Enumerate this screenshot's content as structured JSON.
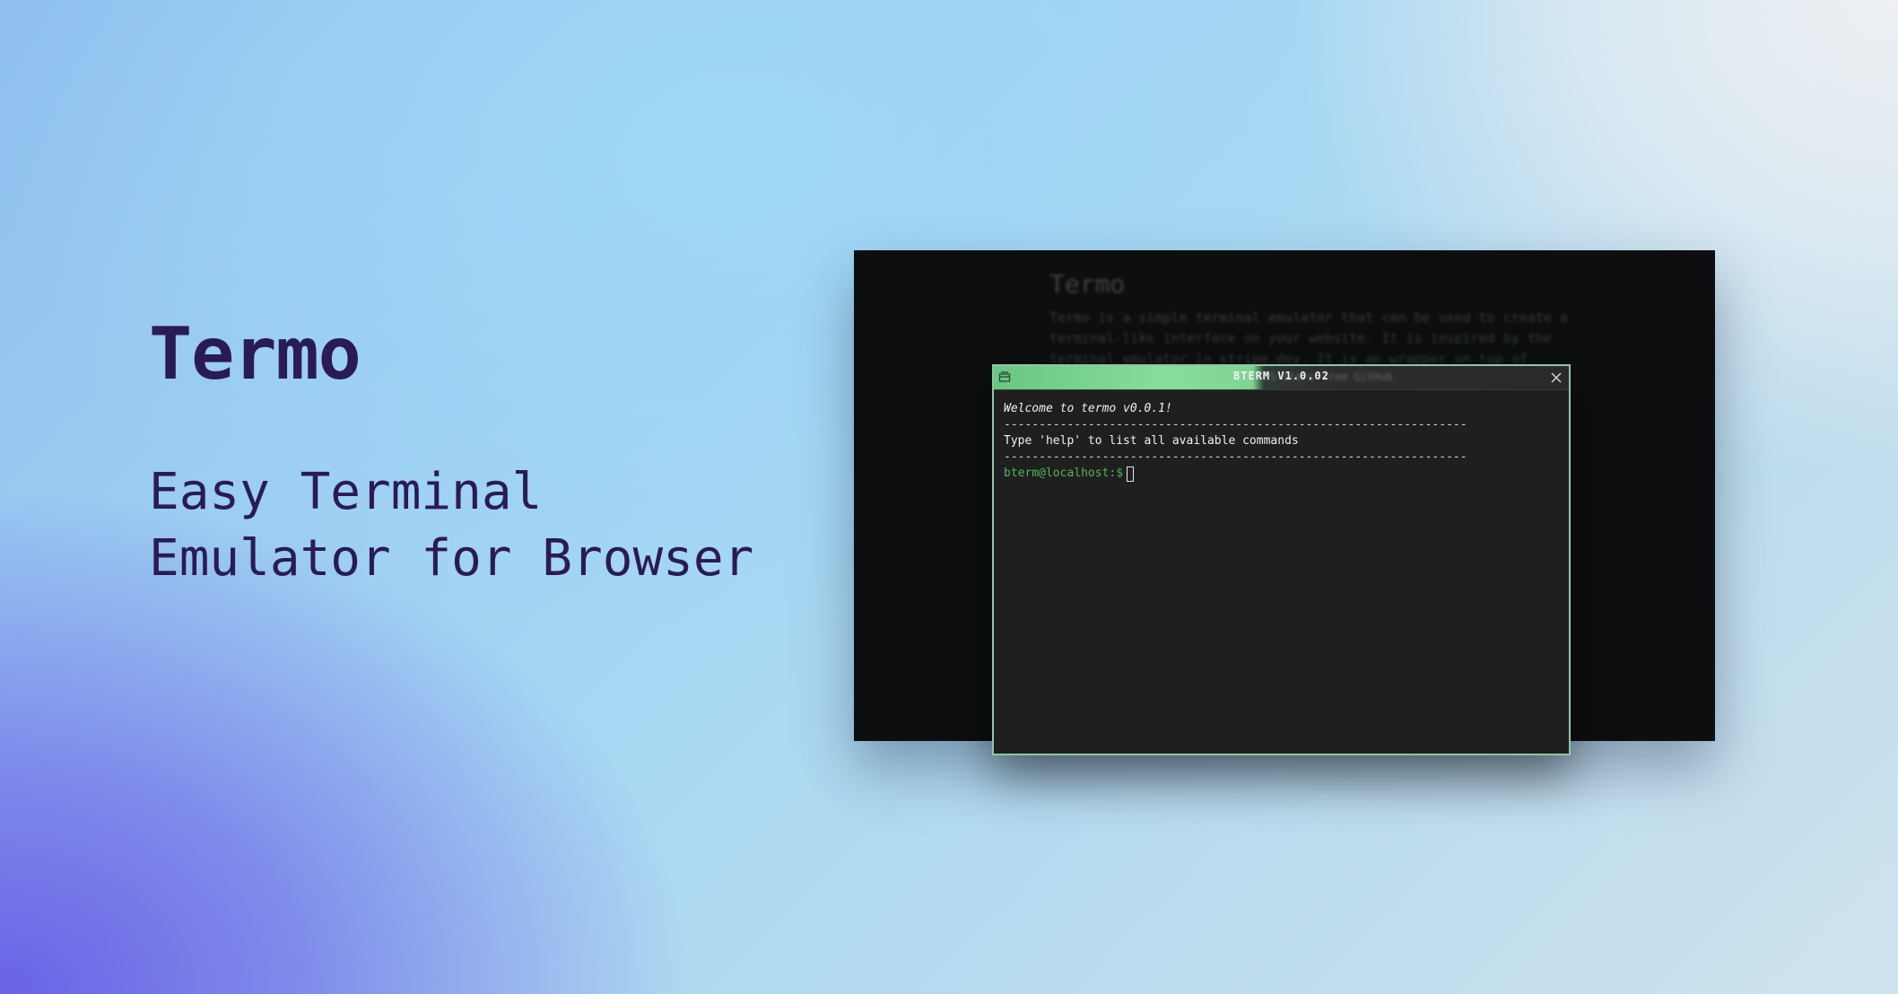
{
  "hero": {
    "title": "Termo",
    "subtitle_line1": "Easy Terminal",
    "subtitle_line2": "Emulator for Browser"
  },
  "background_page": {
    "title": "Termo",
    "lines": [
      "Termo is a simple terminal emulator that can be used to create a",
      "terminal-like interface on your website. It is inspired by the",
      "terminal emulator in stripe.dev. It is an wrapper on top of"
    ],
    "ghost_text": "OS  Stars  from GitHub"
  },
  "terminal": {
    "title": "BTERM V1.0.02",
    "welcome": "Welcome to termo v0.0.1!",
    "divider": "------------------------------------------------------------------",
    "help": "Type 'help' to list all available commands",
    "prompt": "bterm@localhost:$",
    "accent_color": "#52b35a",
    "border_color": "#8ec7a6",
    "icons": {
      "window": "window-icon",
      "close": "close-icon"
    }
  }
}
